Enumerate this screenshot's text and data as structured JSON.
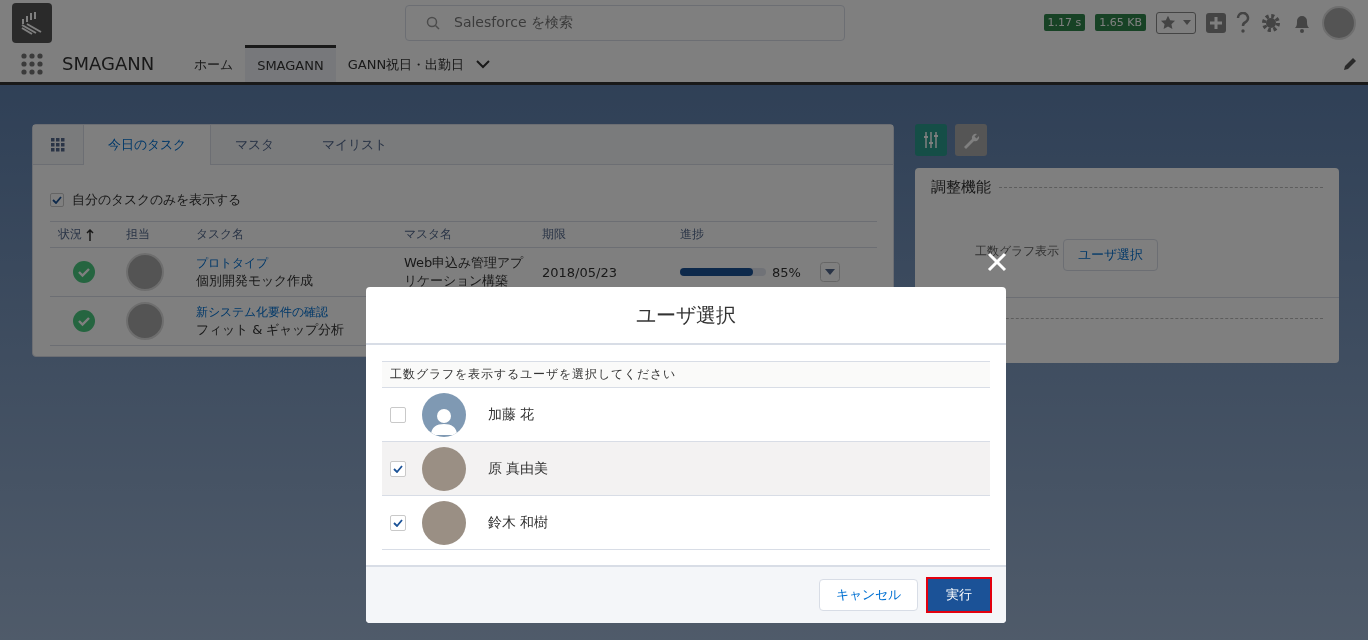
{
  "header": {
    "search": {
      "placeholder": "Salesforce を検索"
    },
    "badges": [
      "1.17 s",
      "1.65 KB"
    ]
  },
  "nav": {
    "app_name": "SMAGANN",
    "tabs": [
      {
        "label": "ホーム",
        "selected": false
      },
      {
        "label": "SMAGANN",
        "selected": true
      },
      {
        "label": "GANN祝日・出勤日",
        "selected": false
      }
    ]
  },
  "task_card": {
    "tabs": [
      {
        "label": "今日のタスク",
        "selected": true
      },
      {
        "label": "マスタ",
        "selected": false
      },
      {
        "label": "マイリスト",
        "selected": false
      }
    ],
    "filter": {
      "label": "自分のタスクのみを表示する",
      "checked": true
    },
    "columns": [
      "状況",
      "担当",
      "タスク名",
      "マスタ名",
      "期限",
      "進捗"
    ],
    "rows": [
      {
        "done": true,
        "category": "プロトタイプ",
        "task": "個別開発モック作成",
        "master": "Web申込み管理アプリケーション構築",
        "due": "2018/05/23",
        "level": 0.85,
        "reading": "85%"
      },
      {
        "done": true,
        "category": "新システム化要件の確認",
        "task": "フィット & ギャップ分析"
      }
    ]
  },
  "side_panel": {
    "tools": [
      {
        "kind": "sliders",
        "selected": true
      },
      {
        "kind": "wrench",
        "selected": false
      }
    ],
    "title": "調整機能",
    "label": "工数グラフ表示",
    "button": "ユーザ選択"
  },
  "modal": {
    "title": "ユーザ選択",
    "caption": "工数グラフを表示するユーザを選択してください",
    "users": [
      {
        "name": "加藤 花",
        "checked": false,
        "hovered": false,
        "photo": false
      },
      {
        "name": "原 真由美",
        "checked": true,
        "hovered": true,
        "photo": true
      },
      {
        "name": "鈴木 和樹",
        "checked": true,
        "hovered": false,
        "photo": true
      }
    ],
    "buttons": [
      {
        "label": "キャンセル",
        "kind": "neutral"
      },
      {
        "label": "実行",
        "kind": "brand"
      }
    ]
  }
}
